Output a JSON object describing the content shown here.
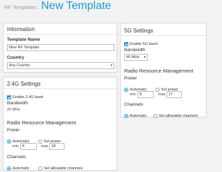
{
  "header": {
    "breadcrumb": "RF Templates",
    "separator": ":",
    "title": "New Template"
  },
  "info": {
    "heading": "Information",
    "name_label": "Template Name",
    "name_value": "New RF Template",
    "country_label": "Country",
    "country_value": "Any Country"
  },
  "band24": {
    "heading": "2.4G Settings",
    "enable_label": "Enable 2.4G band",
    "bandwidth_label": "Bandwidth",
    "bandwidth_value": "20 MHz",
    "rrm_heading": "Radio Resource Management",
    "power_label": "Power",
    "power_auto": "Automatic",
    "power_set": "Set power",
    "min_label": "min",
    "min_value": "8",
    "max_label": "max",
    "max_value": "18",
    "channels_label": "Channels",
    "channels_auto": "Automatic",
    "channels_set": "Set allowable channels"
  },
  "band5": {
    "heading": "5G Settings",
    "enable_label": "Enable 5G band",
    "bandwidth_label": "Bandwidth",
    "bandwidth_value": "40 MHz",
    "rrm_heading": "Radio Resource Management",
    "power_label": "Power",
    "power_auto": "Automatic",
    "power_set": "Set power",
    "min_label": "min",
    "min_value": "8",
    "max_label": "max",
    "max_value": "17",
    "channels_label": "Channels",
    "channels_auto": "Automatic",
    "channels_set": "Set allowable channels"
  },
  "colors": {
    "accent": "#1a9bd7",
    "panel_border": "#d8d8d8",
    "background": "#f2f2f2"
  }
}
